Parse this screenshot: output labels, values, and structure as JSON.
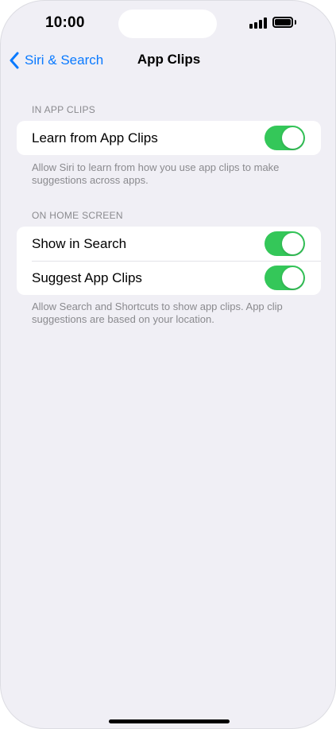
{
  "status_bar": {
    "time": "10:00"
  },
  "nav": {
    "back_label": "Siri & Search",
    "title": "App Clips"
  },
  "sections": [
    {
      "header": "IN APP CLIPS",
      "rows": [
        {
          "label": "Learn from App Clips",
          "toggle_on": true
        }
      ],
      "footer": "Allow Siri to learn from how you use app clips to make suggestions across apps."
    },
    {
      "header": "ON HOME SCREEN",
      "rows": [
        {
          "label": "Show in Search",
          "toggle_on": true
        },
        {
          "label": "Suggest App Clips",
          "toggle_on": true
        }
      ],
      "footer": "Allow Search and Shortcuts to show app clips. App clip suggestions are based on your location."
    }
  ],
  "colors": {
    "accent": "#0a7aff",
    "toggle_on": "#34c759",
    "background": "#f0eff5",
    "secondary_text": "#8a8a8e"
  }
}
